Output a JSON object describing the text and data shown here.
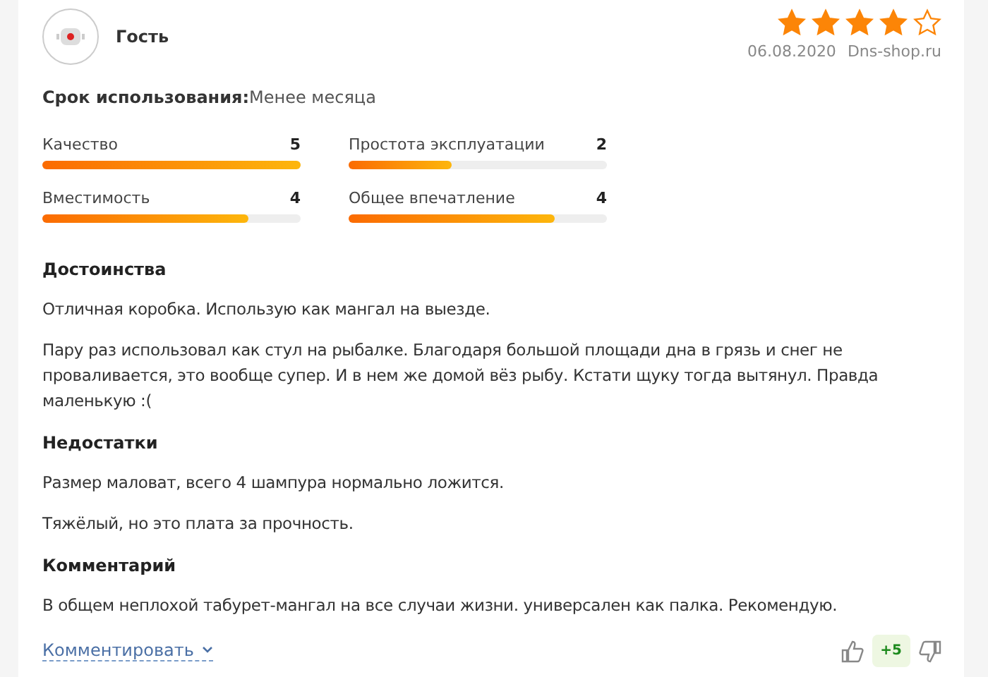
{
  "author": {
    "name": "Гость"
  },
  "rating": {
    "stars": 4
  },
  "date": "06.08.2020",
  "source": "Dns-shop.ru",
  "usage": {
    "label": "Срок использования:",
    "value": "Менее месяца"
  },
  "scores": [
    {
      "label": "Качество",
      "value": "5",
      "level": 1.0
    },
    {
      "label": "Простота эксплуатации",
      "value": "2",
      "level": 0.4
    },
    {
      "label": "Вместимость",
      "value": "4",
      "level": 0.8
    },
    {
      "label": "Общее впечатление",
      "value": "4",
      "level": 0.8
    }
  ],
  "sections": [
    {
      "title": "Достоинства",
      "paragraphs": [
        "Отличная коробка. Использую как мангал на выезде.",
        "Пару раз использовал как стул на рыбалке. Благодаря большой площади дна в грязь и снег не проваливается, это вообще супер. И в нем же домой вёз рыбу. Кстати щуку тогда вытянул. Правда маленькую :("
      ]
    },
    {
      "title": "Недостатки",
      "paragraphs": [
        "Размер маловат, всего 4 шампура нормально ложится.",
        "Тяжёлый, но это плата за прочность."
      ]
    },
    {
      "title": "Комментарий",
      "paragraphs": [
        "В общем неплохой табурет-мангал на все случаи жизни. универсален как палка. Рекомендую."
      ]
    }
  ],
  "comment_link": "Комментировать",
  "votes": "+5"
}
